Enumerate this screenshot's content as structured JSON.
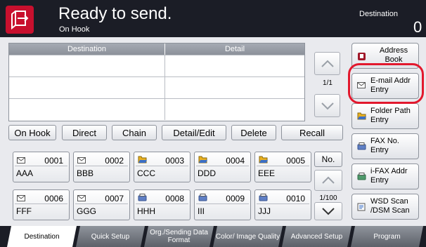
{
  "header": {
    "title": "Ready to send.",
    "subtitle": "On Hook",
    "destination_label": "Destination",
    "destination_count": "0"
  },
  "table": {
    "columns": [
      "Destination",
      "Detail"
    ],
    "page_indicator": "1/1"
  },
  "actions": [
    "On Hook",
    "Direct",
    "Chain",
    "Detail/Edit",
    "Delete",
    "Recall"
  ],
  "one_touch_keys": [
    {
      "number": "0001",
      "name": "AAA",
      "icon": "email-icon"
    },
    {
      "number": "0002",
      "name": "BBB",
      "icon": "email-icon"
    },
    {
      "number": "0003",
      "name": "CCC",
      "icon": "folder-icon"
    },
    {
      "number": "0004",
      "name": "DDD",
      "icon": "folder-icon"
    },
    {
      "number": "0005",
      "name": "EEE",
      "icon": "folder-icon"
    },
    {
      "number": "0006",
      "name": "FFF",
      "icon": "email-icon"
    },
    {
      "number": "0007",
      "name": "GGG",
      "icon": "email-icon"
    },
    {
      "number": "0008",
      "name": "HHH",
      "icon": "fax-icon"
    },
    {
      "number": "0009",
      "name": "III",
      "icon": "fax-icon"
    },
    {
      "number": "0010",
      "name": "JJJ",
      "icon": "fax-icon"
    }
  ],
  "keys_nav": {
    "no_label": "No.",
    "page_indicator": "1/100"
  },
  "side_buttons": [
    {
      "label": "Address Book",
      "icon": "address-book-icon"
    },
    {
      "label": "E-mail Addr Entry",
      "icon": "email-icon"
    },
    {
      "label": "Folder Path Entry",
      "icon": "folder-icon"
    },
    {
      "label": "FAX No. Entry",
      "icon": "fax-icon"
    },
    {
      "label": "i-FAX Addr Entry",
      "icon": "ifax-icon"
    },
    {
      "label": "WSD Scan /DSM Scan",
      "icon": "wsd-scan-icon"
    }
  ],
  "tabs": [
    {
      "label": "Destination",
      "active": true
    },
    {
      "label": "Quick Setup"
    },
    {
      "label": "Org./Sending Data Format"
    },
    {
      "label": "Color/ Image Quality"
    },
    {
      "label": "Advanced Setup"
    },
    {
      "label": "Program"
    }
  ],
  "colors": {
    "header_bg": "#1b1d26",
    "back_button": "#c8102e",
    "highlight_ring": "#e2182d"
  }
}
